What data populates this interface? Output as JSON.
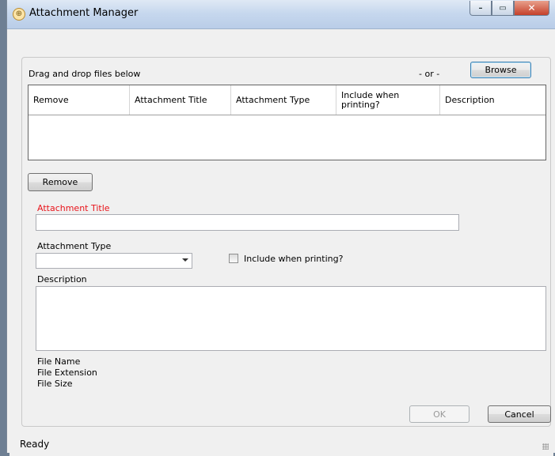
{
  "window": {
    "title": "Attachment Manager",
    "icon": "attachment-app-icon",
    "controls": {
      "minimize": "–",
      "maximize": "▭",
      "close": "✕"
    }
  },
  "drop_area": {
    "instruction": "Drag and drop files below",
    "or_label": "- or -",
    "browse_label": "Browse"
  },
  "grid": {
    "columns": [
      "Remove",
      "Attachment Title",
      "Attachment Type",
      "Include when printing?",
      "Description"
    ],
    "rows": []
  },
  "form": {
    "remove_label": "Remove",
    "title_label": "Attachment Title",
    "title_value": "",
    "title_label_color": "#e8141b",
    "type_label": "Attachment Type",
    "type_value": "",
    "include_label": "Include when printing?",
    "include_checked": false,
    "description_label": "Description",
    "description_value": "",
    "file_name_label": "File Name",
    "file_extension_label": "File Extension",
    "file_size_label": "File Size"
  },
  "actions": {
    "ok_label": "OK",
    "cancel_label": "Cancel"
  },
  "status": {
    "text": "Ready"
  }
}
